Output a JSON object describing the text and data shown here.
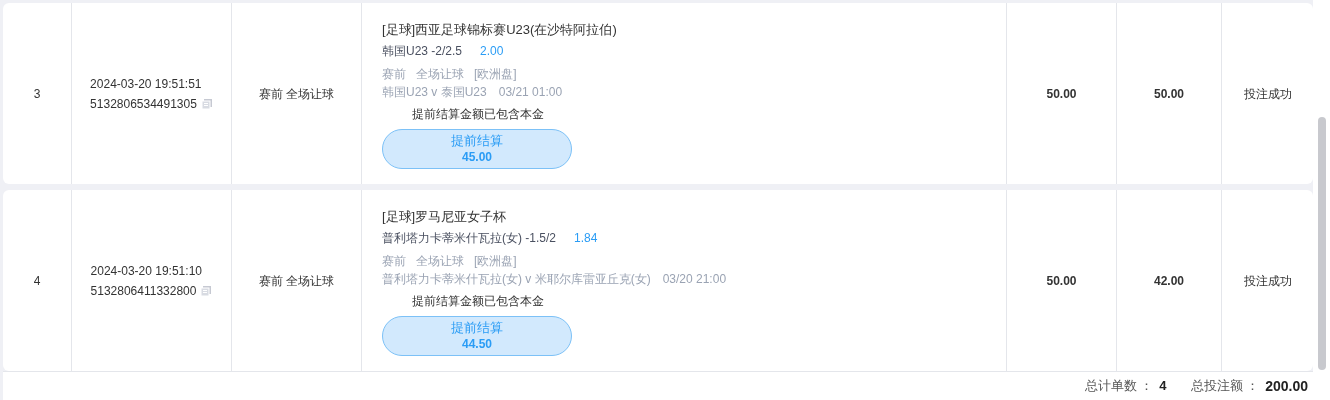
{
  "rows": [
    {
      "index": "3",
      "time": "2024-03-20 19:51:51",
      "order_no": "5132806534491305",
      "bet_type": "赛前 全场让球",
      "league": "[足球]西亚足球锦标赛U23(在沙特阿拉伯)",
      "selection": "韩国U23 -2/2.5",
      "odds": "2.00",
      "market": [
        "赛前",
        "全场让球",
        "[欧洲盘]"
      ],
      "match": "韩国U23 v 泰国U23",
      "match_time": "03/21 01:00",
      "note": "提前结算金额已包含本金",
      "cashout_label": "提前结算",
      "cashout_amount": "45.00",
      "stake": "50.00",
      "payout": "50.00",
      "status": "投注成功"
    },
    {
      "index": "4",
      "time": "2024-03-20 19:51:10",
      "order_no": "5132806411332800",
      "bet_type": "赛前 全场让球",
      "league": "[足球]罗马尼亚女子杯",
      "selection": "普利塔力卡蒂米什瓦拉(女) -1.5/2",
      "odds": "1.84",
      "market": [
        "赛前",
        "全场让球",
        "[欧洲盘]"
      ],
      "match": "普利塔力卡蒂米什瓦拉(女) v 米耶尔库雷亚丘克(女)",
      "match_time": "03/20 21:00",
      "note": "提前结算金额已包含本金",
      "cashout_label": "提前结算",
      "cashout_amount": "44.50",
      "stake": "50.00",
      "payout": "42.00",
      "status": "投注成功"
    }
  ],
  "footer": {
    "count_label": "总计单数 ：",
    "count": "4",
    "total_label": "总投注额 ：",
    "total": "200.00"
  }
}
